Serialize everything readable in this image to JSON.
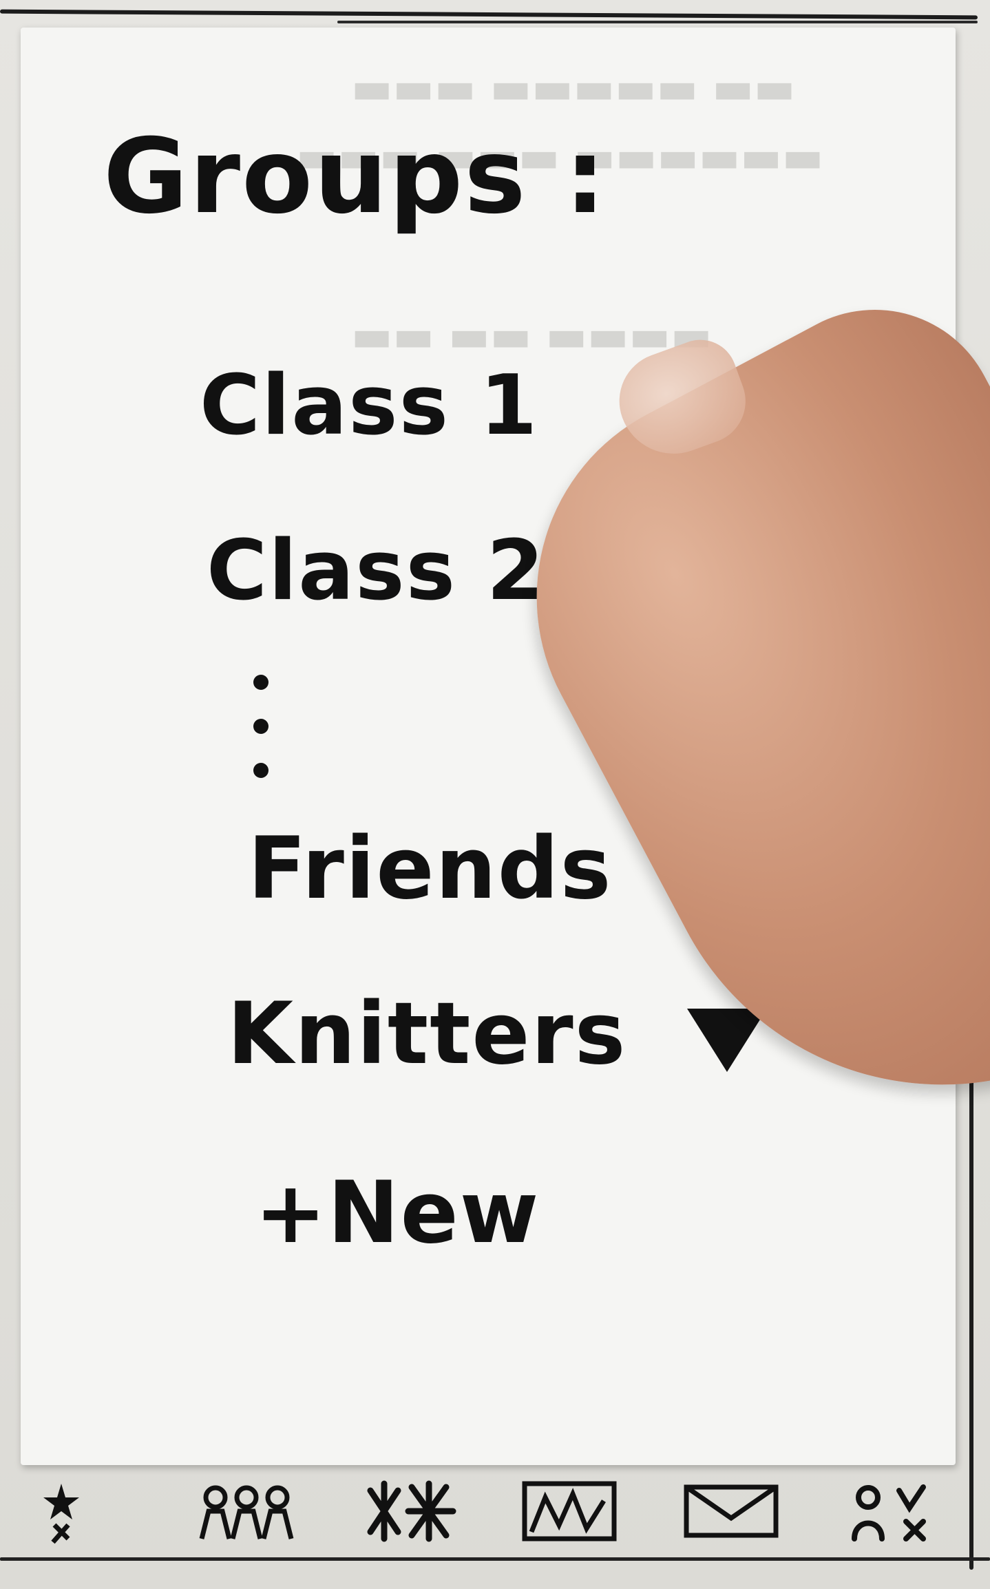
{
  "screen": {
    "title": "Groups :",
    "groups": [
      {
        "label": "Class 1"
      },
      {
        "label": "Class 2"
      },
      {
        "label": "Friends",
        "has_dropdown": true
      },
      {
        "label": "Knitters",
        "has_dropdown": true
      }
    ],
    "new_label": "+New"
  },
  "tabbar": {
    "tabs": [
      {
        "icon": "star-person-icon"
      },
      {
        "icon": "group-people-icon"
      },
      {
        "icon": "knitting-icon"
      },
      {
        "icon": "map-icon"
      },
      {
        "icon": "mail-icon"
      },
      {
        "icon": "profile-settings-icon"
      }
    ]
  }
}
